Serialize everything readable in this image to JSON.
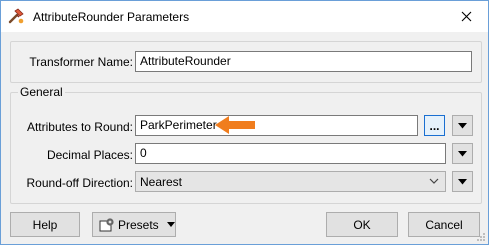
{
  "window": {
    "title": "AttributeRounder Parameters",
    "icons": {
      "app": "transformer-icon",
      "close": "close-icon"
    }
  },
  "transformer": {
    "label": "Transformer Name:",
    "value": "AttributeRounder"
  },
  "general": {
    "legend": "General",
    "attributes": {
      "label": "Attributes to Round:",
      "value": "ParkPerimeter",
      "browse_label": "..."
    },
    "decimal": {
      "label": "Decimal Places:",
      "value": "0"
    },
    "direction": {
      "label": "Round-off Direction:",
      "value": "Nearest"
    }
  },
  "buttons": {
    "help": "Help",
    "presets": "Presets",
    "ok": "OK",
    "cancel": "Cancel"
  },
  "colors": {
    "annotation_arrow": "#f07d1e",
    "accent": "#1a6fd1"
  }
}
